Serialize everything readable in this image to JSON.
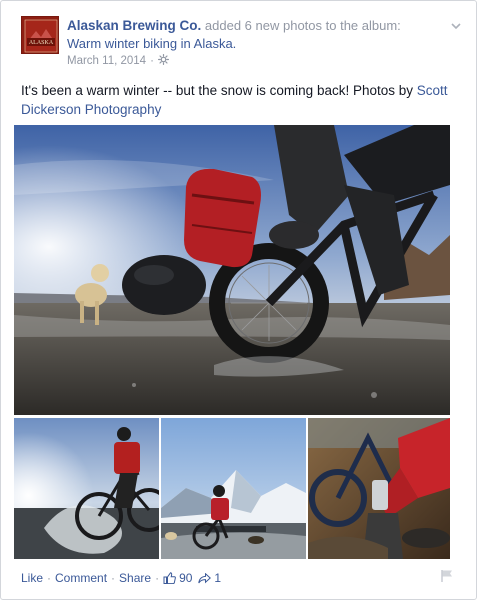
{
  "post": {
    "page_name": "Alaskan Brewing Co.",
    "action_text": "added 6 new photos to the album:",
    "album_title": "Warm winter biking in Alaska.",
    "date": "March 11, 2014",
    "separator": "·",
    "audience_icon": "globe-icon",
    "avatar_text": "ALASKA",
    "body_text": "It's been a warm winter -- but the snow is coming back! Photos by ",
    "photographer_link": "Scott Dickerson Photography"
  },
  "photos": [
    {
      "name": "photo-main",
      "icon": "fat-bike-dog-photo"
    },
    {
      "name": "photo-thumb-1",
      "icon": "rider-splash-photo"
    },
    {
      "name": "photo-thumb-2",
      "icon": "rider-mountains-photo"
    },
    {
      "name": "photo-thumb-3",
      "icon": "rider-red-jacket-photo"
    }
  ],
  "actions": {
    "like_label": "Like",
    "comment_label": "Comment",
    "share_label": "Share",
    "dot": "·",
    "like_count": "90",
    "share_count": "1"
  },
  "colors": {
    "link": "#3b5998",
    "muted": "#9197a3",
    "text": "#141823",
    "border": "#d3d6db"
  }
}
